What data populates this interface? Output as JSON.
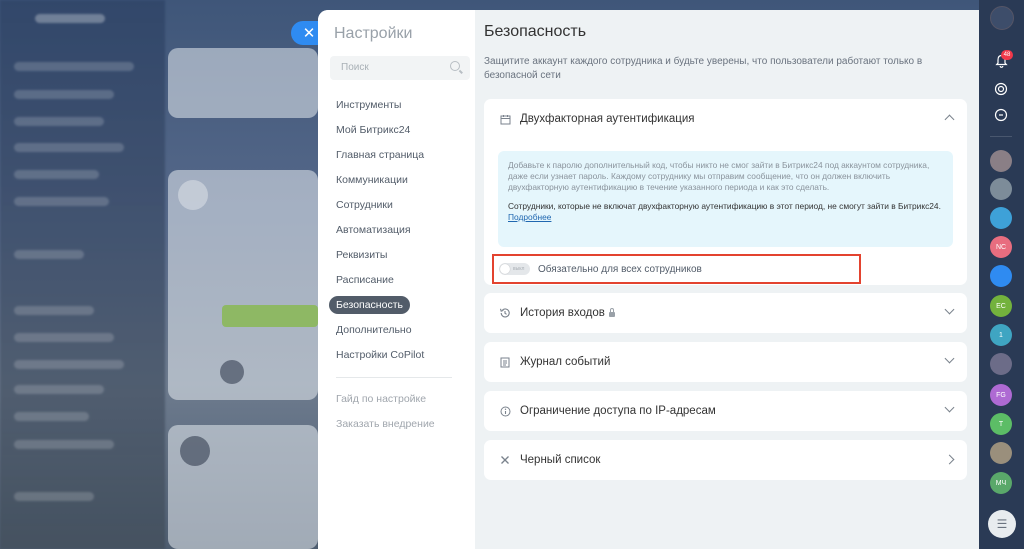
{
  "nav": {
    "title": "Настройки",
    "search_placeholder": "Поиск",
    "items": [
      {
        "label": "Инструменты"
      },
      {
        "label": "Мой Битрикс24"
      },
      {
        "label": "Главная страница"
      },
      {
        "label": "Коммуникации"
      },
      {
        "label": "Сотрудники"
      },
      {
        "label": "Автоматизация"
      },
      {
        "label": "Реквизиты"
      },
      {
        "label": "Расписание"
      },
      {
        "label": "Безопасность",
        "active": true
      },
      {
        "label": "Дополнительно"
      },
      {
        "label": "Настройки CoPilot"
      }
    ],
    "extra": [
      {
        "label": "Гайд по настройке"
      },
      {
        "label": "Заказать внедрение"
      }
    ]
  },
  "content": {
    "title": "Безопасность",
    "description": "Защитите аккаунт каждого сотрудника и будьте уверены, что пользователи работают только в безопасной сети",
    "two_factor": {
      "title": "Двухфакторная аутентификация",
      "info": "Добавьте к паролю дополнительный код, чтобы никто не смог зайти в Битрикс24 под аккаунтом сотрудника, даже если узнает пароль. Каждому сотруднику мы отправим сообщение, что он должен включить двухфакторную аутентификацию в течение указанного периода и как это сделать.",
      "warning": "Сотрудники, которые не включат двухфакторную аутентификацию в этот период, не смогут зайти в Битрикс24.",
      "link": "Подробнее",
      "toggle_state": "выкл",
      "toggle_label": "Обязательно для всех сотрудников"
    },
    "sections": [
      {
        "title": "История входов",
        "icon": "history-icon",
        "locked": true
      },
      {
        "title": "Журнал событий",
        "icon": "journal-icon"
      },
      {
        "title": "Ограничение доступа по IP-адресам",
        "icon": "info-icon"
      },
      {
        "title": "Черный список",
        "icon": "close-x-icon"
      }
    ]
  },
  "rightbar": {
    "notification_count": "48",
    "avatar_initials": [
      "NC",
      "EC",
      "1",
      "FG",
      "T",
      "МЧ"
    ]
  },
  "colors": {
    "accent": "#2f8bf1",
    "highlight": "#e3432f",
    "info_bg": "#e5f6fc"
  }
}
